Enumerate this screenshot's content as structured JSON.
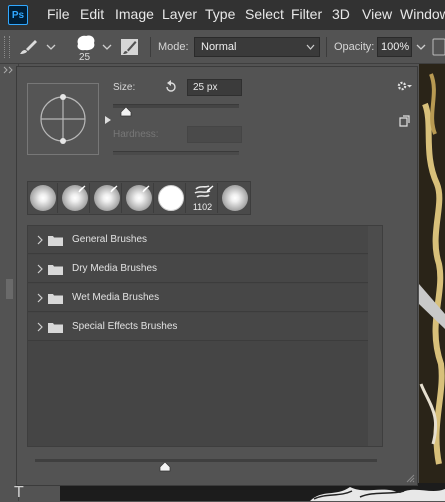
{
  "menubar": {
    "logo": "Ps",
    "items": [
      "File",
      "Edit",
      "Image",
      "Layer",
      "Type",
      "Select",
      "Filter",
      "3D",
      "View",
      "Window"
    ]
  },
  "options": {
    "brush_size_preview": "25",
    "mode_label": "Mode:",
    "mode_value": "Normal",
    "opacity_label": "Opacity:",
    "opacity_value": "100%"
  },
  "panel": {
    "size_label": "Size:",
    "size_value": "25 px",
    "hardness_label": "Hardness:",
    "hardness_value": "",
    "size_slider_fraction": 0.1,
    "bottom_slider_fraction": 0.38,
    "brush_thumbnails": [
      {
        "kind": "soft",
        "pen": false,
        "number": ""
      },
      {
        "kind": "soft",
        "pen": true,
        "number": ""
      },
      {
        "kind": "soft",
        "pen": true,
        "number": ""
      },
      {
        "kind": "soft",
        "pen": true,
        "number": ""
      },
      {
        "kind": "hard",
        "pen": false,
        "number": ""
      },
      {
        "kind": "texture",
        "pen": true,
        "number": "1102"
      },
      {
        "kind": "soft",
        "pen": false,
        "number": ""
      }
    ],
    "groups": [
      "General Brushes",
      "Dry Media Brushes",
      "Wet Media Brushes",
      "Special Effects Brushes"
    ]
  },
  "colors": {
    "menubar": "#323232",
    "panel": "#535353",
    "ps_blue": "#31a8ff"
  }
}
